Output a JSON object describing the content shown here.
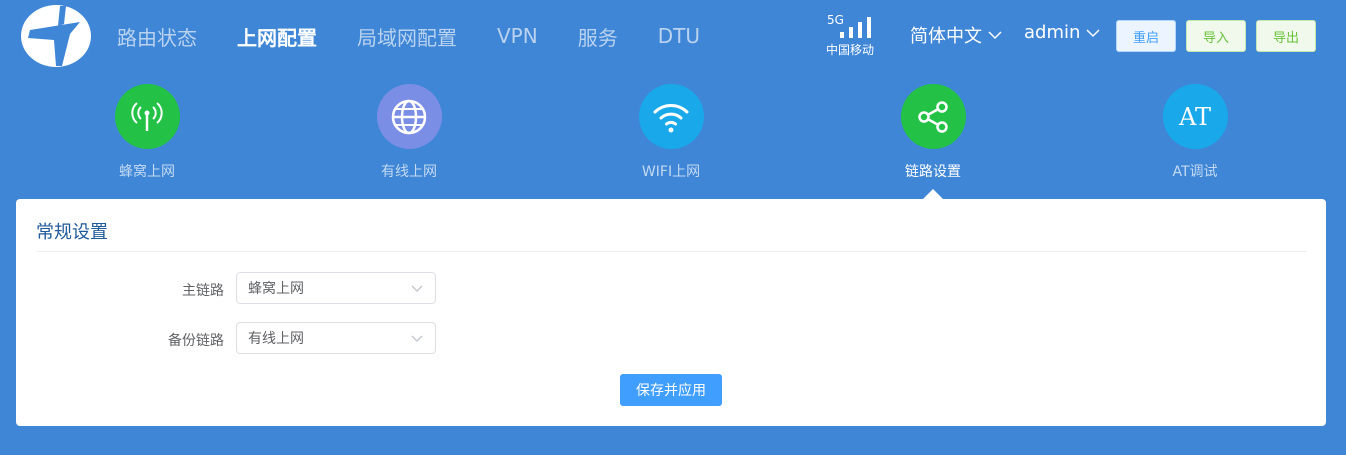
{
  "nav": {
    "items": [
      {
        "label": "路由状态",
        "active": false
      },
      {
        "label": "上网配置",
        "active": true
      },
      {
        "label": "局域网配置",
        "active": false
      },
      {
        "label": "VPN",
        "active": false
      },
      {
        "label": "服务",
        "active": false
      },
      {
        "label": "DTU",
        "active": false
      }
    ]
  },
  "signal": {
    "network_type": "5G",
    "carrier": "中国移动",
    "level": 4
  },
  "language": {
    "selected": "简体中文"
  },
  "user": {
    "name": "admin"
  },
  "buttons": {
    "reboot": "重启",
    "import": "导入",
    "export": "导出"
  },
  "tabs": [
    {
      "label": "蜂窝上网",
      "icon": "antenna-icon",
      "color": "#23c145"
    },
    {
      "label": "有线上网",
      "icon": "globe-icon",
      "color": "#7b8ee6"
    },
    {
      "label": "WIFI上网",
      "icon": "wifi-icon",
      "color": "#19a8ea"
    },
    {
      "label": "链路设置",
      "icon": "share-icon",
      "color": "#23c145",
      "active": true
    },
    {
      "label": "AT调试",
      "icon": "at-icon",
      "text": "AT",
      "color": "#19a8ea"
    }
  ],
  "card": {
    "title": "常规设置",
    "form": {
      "main_link": {
        "label": "主链路",
        "value": "蜂窝上网"
      },
      "backup_link": {
        "label": "备份链路",
        "value": "有线上网"
      }
    },
    "save_button": "保存并应用"
  },
  "colors": {
    "background": "#3f86d6",
    "primary": "#409eff",
    "success": "#67c23a",
    "tab_green": "#23c145",
    "tab_blue": "#19a8ea",
    "tab_purple": "#7b8ee6"
  }
}
